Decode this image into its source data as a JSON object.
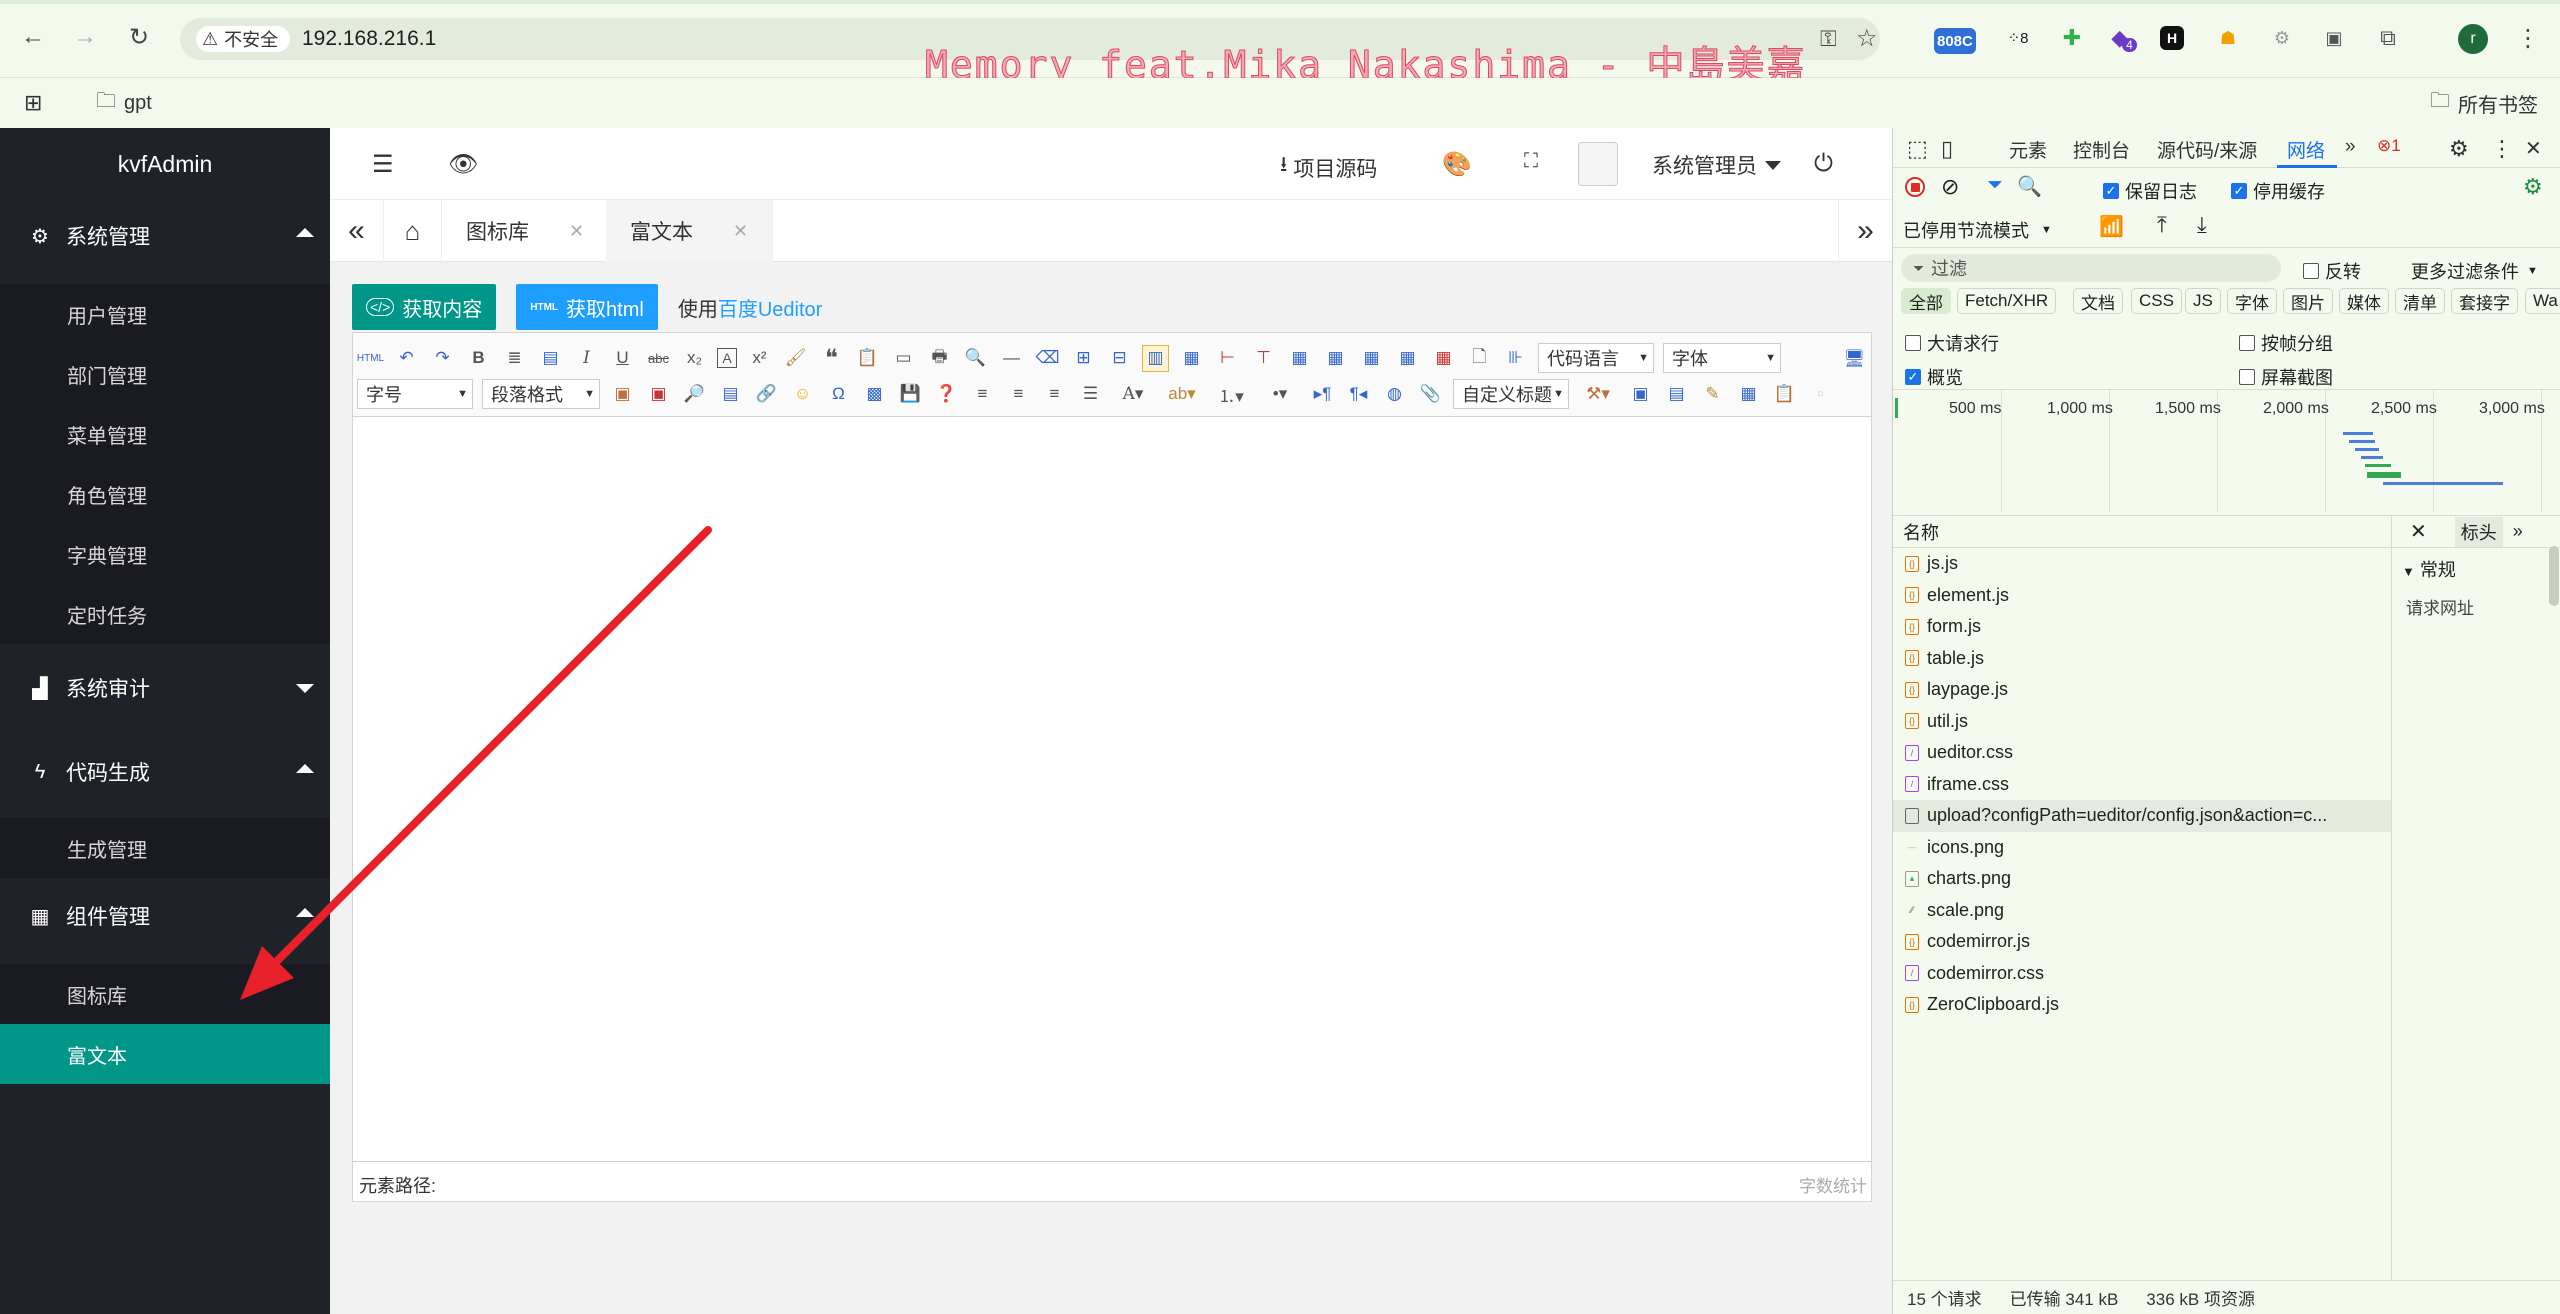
{
  "browser": {
    "security_label": "不安全",
    "url": "192.168.216.1",
    "marquee": "Memory feat.Mika Nakashima - 中島美嘉",
    "ext_badge_1": "808C",
    "ext_badge_2": "8",
    "ext_badge_3": "4",
    "profile_initial": "r",
    "bookmark_folder": "gpt",
    "all_bookmarks": "所有书签"
  },
  "sidebar": {
    "logo": "kvfAdmin",
    "groups": [
      {
        "label": "系统管理",
        "items": [
          "用户管理",
          "部门管理",
          "菜单管理",
          "角色管理",
          "字典管理",
          "定时任务"
        ]
      },
      {
        "label": "系统审计",
        "items": []
      },
      {
        "label": "代码生成",
        "items": [
          "生成管理"
        ]
      },
      {
        "label": "组件管理",
        "items": [
          "图标库",
          "富文本"
        ]
      }
    ]
  },
  "header": {
    "source_label": "项目源码",
    "user_label": "系统管理员"
  },
  "tabs": [
    {
      "label": "图标库"
    },
    {
      "label": "富文本"
    }
  ],
  "content": {
    "btn_get_content": "获取内容",
    "btn_get_html": "获取html",
    "html_badge": "HTML",
    "use_prefix": "使用",
    "use_link": "百度Ueditor",
    "toolbar": {
      "select_code_lang": "代码语言",
      "select_font": "字体",
      "select_size": "字号",
      "select_paragraph": "段落格式",
      "select_custom_title": "自定义标题"
    },
    "status_path": "元素路径:",
    "word_count": "字数统计"
  },
  "devtools": {
    "tabs": [
      "元素",
      "控制台",
      "源代码/来源",
      "网络"
    ],
    "error_count": "1",
    "preserve_log": "保留日志",
    "disable_cache": "停用缓存",
    "throttle": "已停用节流模式",
    "filter_placeholder": "过滤",
    "invert": "反转",
    "more_filters": "更多过滤条件",
    "chips": [
      "全部",
      "Fetch/XHR",
      "文档",
      "CSS",
      "JS",
      "字体",
      "图片",
      "媒体",
      "清单",
      "套接字",
      "Wa"
    ],
    "opt_big_rows": "大请求行",
    "opt_group_by_frame": "按帧分组",
    "opt_overview": "概览",
    "opt_screenshots": "屏幕截图",
    "timeline_labels": [
      "500 ms",
      "1,000 ms",
      "1,500 ms",
      "2,000 ms",
      "2,500 ms",
      "3,000 ms"
    ],
    "name_header": "名称",
    "side_tab": "标头",
    "general": "常规",
    "request_url": "请求网址",
    "requests": [
      {
        "name": "js.js",
        "type": "js"
      },
      {
        "name": "element.js",
        "type": "js"
      },
      {
        "name": "form.js",
        "type": "js"
      },
      {
        "name": "table.js",
        "type": "js"
      },
      {
        "name": "laypage.js",
        "type": "js"
      },
      {
        "name": "util.js",
        "type": "js"
      },
      {
        "name": "ueditor.css",
        "type": "css"
      },
      {
        "name": "iframe.css",
        "type": "css"
      },
      {
        "name": "upload?configPath=ueditor/config.json&action=c...",
        "type": "doc"
      },
      {
        "name": "icons.png",
        "type": "img"
      },
      {
        "name": "charts.png",
        "type": "img"
      },
      {
        "name": "scale.png",
        "type": "img"
      },
      {
        "name": "codemirror.js",
        "type": "js"
      },
      {
        "name": "codemirror.css",
        "type": "css"
      },
      {
        "name": "ZeroClipboard.js",
        "type": "js"
      }
    ],
    "footer_requests": "15 个请求",
    "footer_transferred": "已传输 341 kB",
    "footer_resources": "336 kB 项资源"
  }
}
